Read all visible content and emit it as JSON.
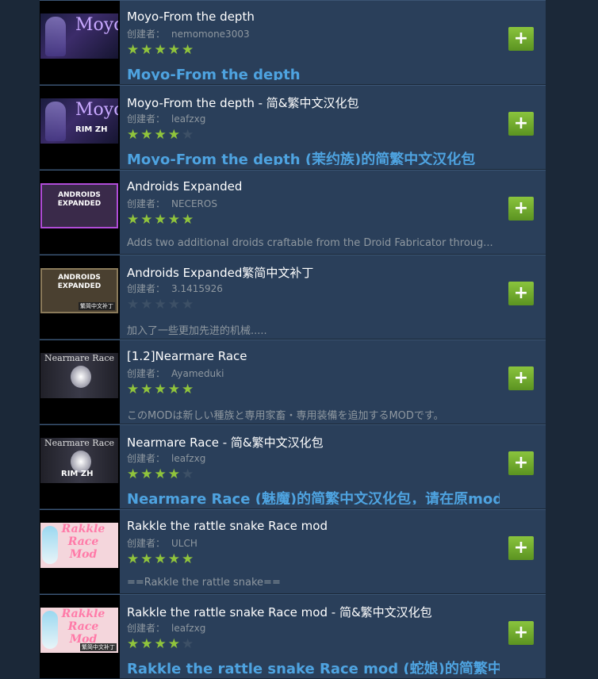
{
  "creator_label": "创建者：",
  "add_label": "+",
  "items": [
    {
      "title": "Moyo-From the depth",
      "author": "nemomone3003",
      "rating": 5,
      "desc": "Moyo-From the depth",
      "desc_style": "big",
      "thumb": "moyo",
      "thumb_logo": "Moyo",
      "thumb_sub": ""
    },
    {
      "title": "Moyo-From the depth - 简&繁中文汉化包",
      "author": "leafzxg",
      "rating": 4,
      "desc": "Moyo-From the depth (茉约族)的简繁中文汉化包",
      "desc_style": "big",
      "thumb": "moyo",
      "thumb_logo": "Moyo",
      "thumb_sub": "RIM ZH"
    },
    {
      "title": "Androids Expanded",
      "author": "NECEROS",
      "rating": 5,
      "desc": "Adds two additional droids craftable from the Droid Fabricator throug...",
      "desc_style": "small",
      "thumb": "android1",
      "thumb_logo": "ANDROIDS EXPANDED",
      "thumb_sub": ""
    },
    {
      "title": "Androids Expanded繁简中文补丁",
      "author": "3.1415926",
      "rating": 0,
      "desc": "加入了一些更加先进的机械.....",
      "desc_style": "small",
      "thumb": "android2",
      "thumb_logo": "ANDROIDS EXPANDED",
      "thumb_sub": "繁简中文补丁"
    },
    {
      "title": "[1.2]Nearmare Race",
      "author": "Ayameduki",
      "rating": 5,
      "desc": "このMODは新しい種族と専用家畜・専用装備を追加するMODです。",
      "desc_style": "small",
      "thumb": "near",
      "thumb_logo": "Nearmare Race",
      "thumb_sub": ""
    },
    {
      "title": "Nearmare Race - 简&繁中文汉化包",
      "author": "leafzxg",
      "rating": 4,
      "desc": "Nearmare Race (魅魔)的简繁中文汉化包，请在原mod",
      "desc_style": "big",
      "thumb": "near",
      "thumb_logo": "Nearmare Race",
      "thumb_sub": "RIM ZH"
    },
    {
      "title": "Rakkle the rattle snake Race mod",
      "author": "ULCH",
      "rating": 5,
      "desc": "==Rakkle the rattle snake==",
      "desc_style": "small",
      "thumb": "rak",
      "thumb_logo": "Rakkle Race Mod",
      "thumb_sub": ""
    },
    {
      "title": "Rakkle the rattle snake Race mod - 简&繁中文汉化包",
      "author": "leafzxg",
      "rating": 4,
      "desc": "Rakkle the rattle snake Race mod (蛇娘)的简繁中文",
      "desc_style": "big",
      "thumb": "rak",
      "thumb_logo": "Rakkle Race Mod",
      "thumb_sub": "繁简中文补丁"
    }
  ]
}
